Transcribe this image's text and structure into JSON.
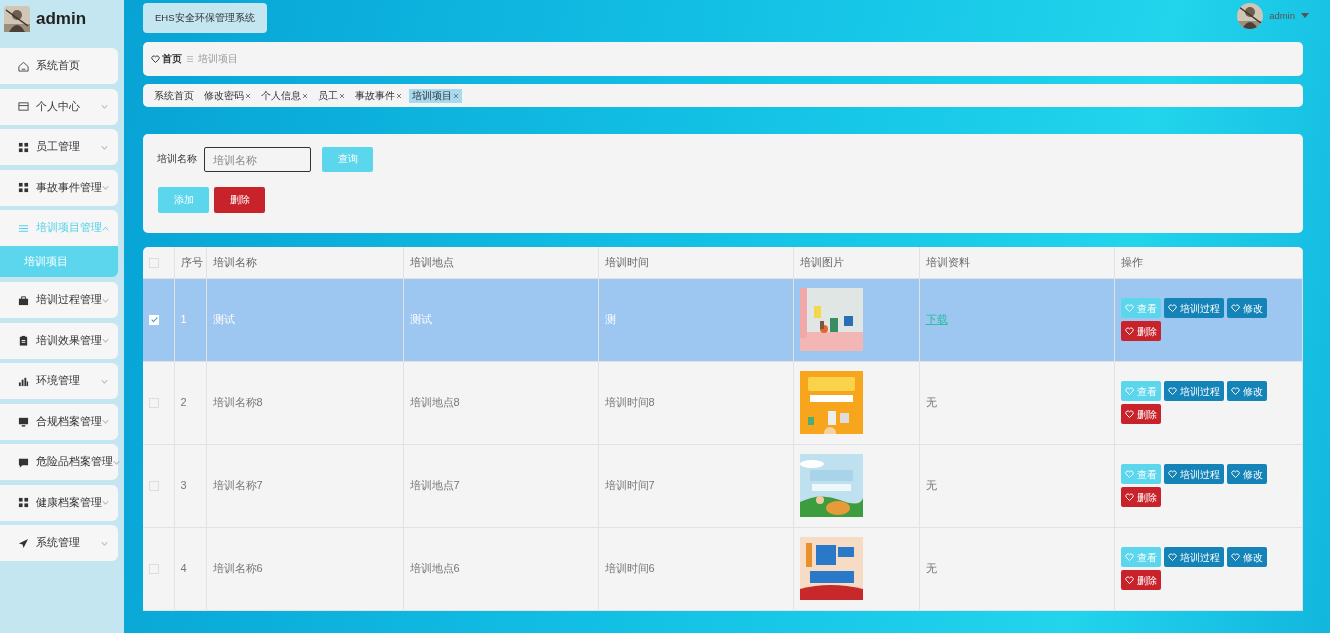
{
  "sidebar": {
    "user": {
      "name": "admin"
    },
    "items": [
      {
        "label": "系统首页",
        "kind": "link",
        "expanded": false
      },
      {
        "label": "个人中心",
        "kind": "menu",
        "expanded": false
      },
      {
        "label": "员工管理",
        "kind": "menu",
        "expanded": false
      },
      {
        "label": "事故事件管理",
        "kind": "menu",
        "expanded": false
      },
      {
        "label": "培训项目管理",
        "kind": "menu",
        "expanded": true,
        "children": [
          {
            "label": "培训项目",
            "selected": true
          }
        ]
      },
      {
        "label": "培训过程管理",
        "kind": "menu",
        "expanded": false
      },
      {
        "label": "培训效果管理",
        "kind": "menu",
        "expanded": false
      },
      {
        "label": "环境管理",
        "kind": "menu",
        "expanded": false
      },
      {
        "label": "合规档案管理",
        "kind": "menu",
        "expanded": false
      },
      {
        "label": "危险品档案管理",
        "kind": "menu",
        "expanded": false
      },
      {
        "label": "健康档案管理",
        "kind": "menu",
        "expanded": false
      },
      {
        "label": "系统管理",
        "kind": "menu",
        "expanded": false
      }
    ]
  },
  "header": {
    "title": "EHS安全环保管理系统",
    "user": "admin"
  },
  "breadcrumb": [
    "首页",
    "培训项目"
  ],
  "tabs": [
    {
      "label": "系统首页",
      "closable": false,
      "selected": false
    },
    {
      "label": "修改密码",
      "closable": true,
      "selected": false
    },
    {
      "label": "个人信息",
      "closable": true,
      "selected": false
    },
    {
      "label": "员工",
      "closable": true,
      "selected": false
    },
    {
      "label": "事故事件",
      "closable": true,
      "selected": false
    },
    {
      "label": "培训项目",
      "closable": true,
      "selected": true
    }
  ],
  "search": {
    "label": "培训名称",
    "placeholder": "培训名称",
    "button": "查询",
    "actions": [
      {
        "label": "添加",
        "kind": "add"
      },
      {
        "label": "删除",
        "kind": "delete"
      }
    ]
  },
  "table": {
    "select_all": {
      "checked": false
    },
    "columns": [
      "序号",
      "培训名称",
      "培训地点",
      "培训时间",
      "培训图片",
      "培训资料",
      "操作"
    ],
    "rows": [
      {
        "selected": true,
        "checked": true,
        "index": "1",
        "name": "测试",
        "place": "测试",
        "time": "测",
        "material": {
          "text": "下载",
          "kind": "link"
        },
        "actions": [
          {
            "label": "查看",
            "kind": "view"
          },
          {
            "label": "培训过程",
            "kind": "primary"
          },
          {
            "label": "修改",
            "kind": "primary"
          },
          {
            "label": "删除",
            "kind": "delete"
          }
        ]
      },
      {
        "selected": false,
        "checked": false,
        "index": "2",
        "name": "培训名称8",
        "place": "培训地点8",
        "time": "培训时间8",
        "material": {
          "text": "无",
          "kind": "text"
        },
        "actions": [
          {
            "label": "查看",
            "kind": "view"
          },
          {
            "label": "培训过程",
            "kind": "primary"
          },
          {
            "label": "修改",
            "kind": "primary"
          },
          {
            "label": "删除",
            "kind": "delete"
          }
        ]
      },
      {
        "selected": false,
        "checked": false,
        "index": "3",
        "name": "培训名称7",
        "place": "培训地点7",
        "time": "培训时间7",
        "material": {
          "text": "无",
          "kind": "text"
        },
        "actions": [
          {
            "label": "查看",
            "kind": "view"
          },
          {
            "label": "培训过程",
            "kind": "primary"
          },
          {
            "label": "修改",
            "kind": "primary"
          },
          {
            "label": "删除",
            "kind": "delete"
          }
        ]
      },
      {
        "selected": false,
        "checked": false,
        "index": "4",
        "name": "培训名称6",
        "place": "培训地点6",
        "time": "培训时间6",
        "material": {
          "text": "无",
          "kind": "text"
        },
        "actions": [
          {
            "label": "查看",
            "kind": "view"
          },
          {
            "label": "培训过程",
            "kind": "primary"
          },
          {
            "label": "修改",
            "kind": "primary"
          },
          {
            "label": "删除",
            "kind": "delete"
          }
        ]
      }
    ]
  }
}
